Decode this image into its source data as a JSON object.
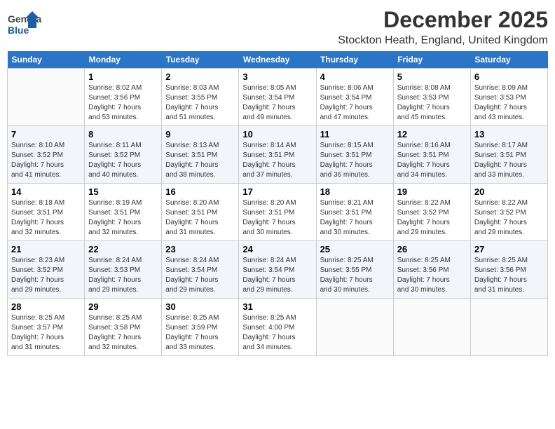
{
  "header": {
    "logo_general": "General",
    "logo_blue": "Blue",
    "month_title": "December 2025",
    "location": "Stockton Heath, England, United Kingdom"
  },
  "days_of_week": [
    "Sunday",
    "Monday",
    "Tuesday",
    "Wednesday",
    "Thursday",
    "Friday",
    "Saturday"
  ],
  "weeks": [
    [
      {
        "day": "",
        "info": ""
      },
      {
        "day": "1",
        "info": "Sunrise: 8:02 AM\nSunset: 3:56 PM\nDaylight: 7 hours\nand 53 minutes."
      },
      {
        "day": "2",
        "info": "Sunrise: 8:03 AM\nSunset: 3:55 PM\nDaylight: 7 hours\nand 51 minutes."
      },
      {
        "day": "3",
        "info": "Sunrise: 8:05 AM\nSunset: 3:54 PM\nDaylight: 7 hours\nand 49 minutes."
      },
      {
        "day": "4",
        "info": "Sunrise: 8:06 AM\nSunset: 3:54 PM\nDaylight: 7 hours\nand 47 minutes."
      },
      {
        "day": "5",
        "info": "Sunrise: 8:08 AM\nSunset: 3:53 PM\nDaylight: 7 hours\nand 45 minutes."
      },
      {
        "day": "6",
        "info": "Sunrise: 8:09 AM\nSunset: 3:53 PM\nDaylight: 7 hours\nand 43 minutes."
      }
    ],
    [
      {
        "day": "7",
        "info": "Sunrise: 8:10 AM\nSunset: 3:52 PM\nDaylight: 7 hours\nand 41 minutes."
      },
      {
        "day": "8",
        "info": "Sunrise: 8:11 AM\nSunset: 3:52 PM\nDaylight: 7 hours\nand 40 minutes."
      },
      {
        "day": "9",
        "info": "Sunrise: 8:13 AM\nSunset: 3:51 PM\nDaylight: 7 hours\nand 38 minutes."
      },
      {
        "day": "10",
        "info": "Sunrise: 8:14 AM\nSunset: 3:51 PM\nDaylight: 7 hours\nand 37 minutes."
      },
      {
        "day": "11",
        "info": "Sunrise: 8:15 AM\nSunset: 3:51 PM\nDaylight: 7 hours\nand 36 minutes."
      },
      {
        "day": "12",
        "info": "Sunrise: 8:16 AM\nSunset: 3:51 PM\nDaylight: 7 hours\nand 34 minutes."
      },
      {
        "day": "13",
        "info": "Sunrise: 8:17 AM\nSunset: 3:51 PM\nDaylight: 7 hours\nand 33 minutes."
      }
    ],
    [
      {
        "day": "14",
        "info": "Sunrise: 8:18 AM\nSunset: 3:51 PM\nDaylight: 7 hours\nand 32 minutes."
      },
      {
        "day": "15",
        "info": "Sunrise: 8:19 AM\nSunset: 3:51 PM\nDaylight: 7 hours\nand 32 minutes."
      },
      {
        "day": "16",
        "info": "Sunrise: 8:20 AM\nSunset: 3:51 PM\nDaylight: 7 hours\nand 31 minutes."
      },
      {
        "day": "17",
        "info": "Sunrise: 8:20 AM\nSunset: 3:51 PM\nDaylight: 7 hours\nand 30 minutes."
      },
      {
        "day": "18",
        "info": "Sunrise: 8:21 AM\nSunset: 3:51 PM\nDaylight: 7 hours\nand 30 minutes."
      },
      {
        "day": "19",
        "info": "Sunrise: 8:22 AM\nSunset: 3:52 PM\nDaylight: 7 hours\nand 29 minutes."
      },
      {
        "day": "20",
        "info": "Sunrise: 8:22 AM\nSunset: 3:52 PM\nDaylight: 7 hours\nand 29 minutes."
      }
    ],
    [
      {
        "day": "21",
        "info": "Sunrise: 8:23 AM\nSunset: 3:52 PM\nDaylight: 7 hours\nand 29 minutes."
      },
      {
        "day": "22",
        "info": "Sunrise: 8:24 AM\nSunset: 3:53 PM\nDaylight: 7 hours\nand 29 minutes."
      },
      {
        "day": "23",
        "info": "Sunrise: 8:24 AM\nSunset: 3:54 PM\nDaylight: 7 hours\nand 29 minutes."
      },
      {
        "day": "24",
        "info": "Sunrise: 8:24 AM\nSunset: 3:54 PM\nDaylight: 7 hours\nand 29 minutes."
      },
      {
        "day": "25",
        "info": "Sunrise: 8:25 AM\nSunset: 3:55 PM\nDaylight: 7 hours\nand 30 minutes."
      },
      {
        "day": "26",
        "info": "Sunrise: 8:25 AM\nSunset: 3:56 PM\nDaylight: 7 hours\nand 30 minutes."
      },
      {
        "day": "27",
        "info": "Sunrise: 8:25 AM\nSunset: 3:56 PM\nDaylight: 7 hours\nand 31 minutes."
      }
    ],
    [
      {
        "day": "28",
        "info": "Sunrise: 8:25 AM\nSunset: 3:57 PM\nDaylight: 7 hours\nand 31 minutes."
      },
      {
        "day": "29",
        "info": "Sunrise: 8:25 AM\nSunset: 3:58 PM\nDaylight: 7 hours\nand 32 minutes."
      },
      {
        "day": "30",
        "info": "Sunrise: 8:25 AM\nSunset: 3:59 PM\nDaylight: 7 hours\nand 33 minutes."
      },
      {
        "day": "31",
        "info": "Sunrise: 8:25 AM\nSunset: 4:00 PM\nDaylight: 7 hours\nand 34 minutes."
      },
      {
        "day": "",
        "info": ""
      },
      {
        "day": "",
        "info": ""
      },
      {
        "day": "",
        "info": ""
      }
    ]
  ]
}
